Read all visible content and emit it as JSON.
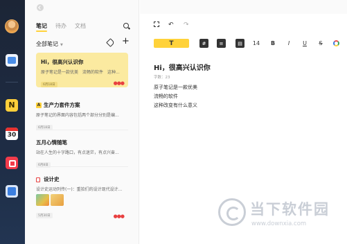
{
  "dock": {
    "apps": [
      "notes-app",
      "n-app",
      "calendar-app",
      "todo-app",
      "screenshot-app"
    ],
    "calendar_day": "30",
    "n_label": "N"
  },
  "list": {
    "tabs": [
      "笔记",
      "待办",
      "文档"
    ],
    "active_tab": "笔记",
    "folder": "全部笔记",
    "notes": [
      {
        "title": "Hi，很高兴认识你",
        "preview": "原子笔记是一款优美　流畅的软件　这种...",
        "date": "6月18日",
        "selected": true
      },
      {
        "badge": "A",
        "title": "生产力套件方案",
        "preview": "原子笔记的界面内容包括两个部分分别是编...",
        "date": "6月18日"
      },
      {
        "title": "五月心情随笔",
        "preview": "站在人生的十字路口，有点迷茫，有点兴奋...",
        "date": "6月8日"
      },
      {
        "title": "设计史",
        "preview": "设计史运动列传(一)：重拾们的设计现代设计...",
        "date": "5月30日"
      }
    ]
  },
  "editor": {
    "toolbar": {
      "text_style": "T",
      "font_size": "14",
      "bold": "B",
      "italic": "I",
      "underline": "U",
      "strike": "S",
      "heading": "#",
      "undo": "↶",
      "redo": "↷"
    },
    "title": "Hi，很高兴认识你",
    "word_count": "字数：23",
    "lines": [
      "原子笔记是一款优美",
      "流畅的软件",
      "这种改变有什么意义"
    ]
  },
  "watermark": {
    "brand": "当下软件园",
    "url": "www.downxia.com"
  },
  "colors": {
    "accent": "#ffd23a",
    "selected_note": "#fbeaa0",
    "dock_bg": "#1c2536",
    "red_dots": "#e84040"
  }
}
